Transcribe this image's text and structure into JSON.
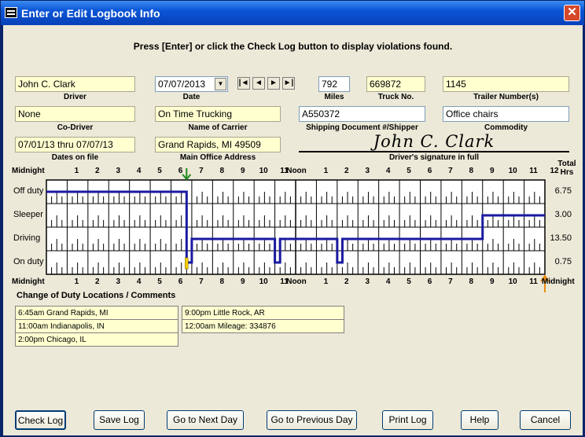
{
  "window": {
    "title": "Enter or Edit Logbook Info",
    "close": "✕"
  },
  "instruction": "Press [Enter] or click the Check Log button to display violations found.",
  "fields": {
    "driver": {
      "value": "John C. Clark",
      "label": "Driver"
    },
    "date": {
      "value": "07/07/2013",
      "label": "Date"
    },
    "miles": {
      "value": "792",
      "label": "Miles"
    },
    "truck_no": {
      "value": "669872",
      "label": "Truck No."
    },
    "trailer": {
      "value": "1145",
      "label": "Trailer Number(s)"
    },
    "co_driver": {
      "value": "None",
      "label": "Co-Driver"
    },
    "carrier": {
      "value": "On Time Trucking",
      "label": "Name of Carrier"
    },
    "shipping": {
      "value": "A550372",
      "label": "Shipping Document #/Shipper"
    },
    "commodity": {
      "value": "Office chairs",
      "label": "Commodity"
    },
    "dates_on_file": {
      "value": "07/01/13 thru 07/07/13",
      "label": "Dates on file"
    },
    "office": {
      "value": "Grand Rapids, MI  49509",
      "label": "Main Office Address"
    },
    "signature": {
      "value": "John C. Clark",
      "label": "Driver's signature in full"
    }
  },
  "nav_buttons": [
    "|◄",
    "◄",
    "►",
    "►|"
  ],
  "grid": {
    "top_labels": [
      "Midnight",
      "1",
      "2",
      "3",
      "4",
      "5",
      "6",
      "7",
      "8",
      "9",
      "10",
      "11",
      "Noon",
      "1",
      "2",
      "3",
      "4",
      "5",
      "6",
      "7",
      "8",
      "9",
      "10",
      "11",
      "12"
    ],
    "bottom_labels": [
      "Midnight",
      "1",
      "2",
      "3",
      "4",
      "5",
      "6",
      "7",
      "8",
      "9",
      "10",
      "11",
      "Noon",
      "1",
      "2",
      "3",
      "4",
      "5",
      "6",
      "7",
      "8",
      "9",
      "10",
      "11",
      "Midnight"
    ],
    "total_header": "Total\nHrs",
    "rows": [
      {
        "name": "Off duty",
        "total": "6.75"
      },
      {
        "name": "Sleeper",
        "total": "3.00"
      },
      {
        "name": "Driving",
        "total": "13.50"
      },
      {
        "name": "On duty",
        "total": "0.75"
      }
    ],
    "duty_segments": [
      {
        "start": 0,
        "end": 6.75,
        "status": 0
      },
      {
        "start": 6.75,
        "end": 7.0,
        "status": 3
      },
      {
        "start": 7.0,
        "end": 11.0,
        "status": 2
      },
      {
        "start": 11.0,
        "end": 11.25,
        "status": 3
      },
      {
        "start": 11.25,
        "end": 14.0,
        "status": 2
      },
      {
        "start": 14.0,
        "end": 14.25,
        "status": 3
      },
      {
        "start": 14.25,
        "end": 21.0,
        "status": 2
      },
      {
        "start": 21.0,
        "end": 24.0,
        "status": 1
      }
    ],
    "line_color": "#1a1aa0",
    "marker_start_hour": 6.75,
    "marker_end_hour": 24
  },
  "locations_header": "Change of Duty Locations / Comments",
  "locations_left": [
    "6:45am Grand Rapids, MI",
    "11:00am Indianapolis, IN",
    "2:00pm Chicago, IL"
  ],
  "locations_right": [
    "9:00pm Little Rock, AR",
    "12:00am Mileage: 334876"
  ],
  "buttons": {
    "check": "Check Log",
    "save": "Save Log",
    "next": "Go to Next Day",
    "prev": "Go to Previous Day",
    "print": "Print Log",
    "help": "Help",
    "cancel": "Cancel"
  }
}
